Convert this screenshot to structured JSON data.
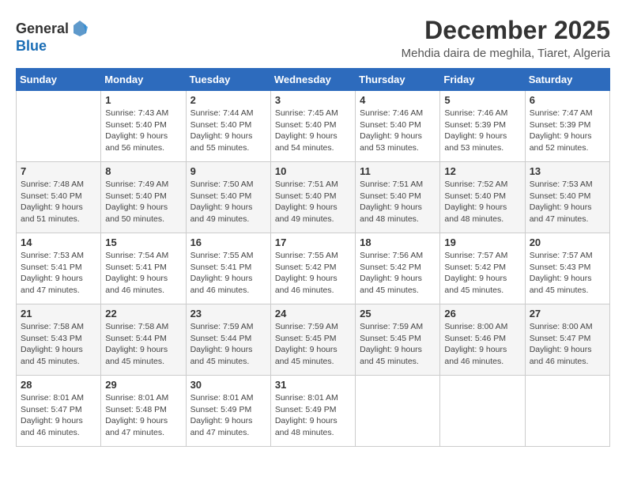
{
  "header": {
    "logo_general": "General",
    "logo_blue": "Blue",
    "title": "December 2025",
    "subtitle": "Mehdia daira de meghila, Tiaret, Algeria"
  },
  "weekdays": [
    "Sunday",
    "Monday",
    "Tuesday",
    "Wednesday",
    "Thursday",
    "Friday",
    "Saturday"
  ],
  "weeks": [
    [
      {
        "day": "",
        "info": ""
      },
      {
        "day": "1",
        "info": "Sunrise: 7:43 AM\nSunset: 5:40 PM\nDaylight: 9 hours\nand 56 minutes."
      },
      {
        "day": "2",
        "info": "Sunrise: 7:44 AM\nSunset: 5:40 PM\nDaylight: 9 hours\nand 55 minutes."
      },
      {
        "day": "3",
        "info": "Sunrise: 7:45 AM\nSunset: 5:40 PM\nDaylight: 9 hours\nand 54 minutes."
      },
      {
        "day": "4",
        "info": "Sunrise: 7:46 AM\nSunset: 5:40 PM\nDaylight: 9 hours\nand 53 minutes."
      },
      {
        "day": "5",
        "info": "Sunrise: 7:46 AM\nSunset: 5:39 PM\nDaylight: 9 hours\nand 53 minutes."
      },
      {
        "day": "6",
        "info": "Sunrise: 7:47 AM\nSunset: 5:39 PM\nDaylight: 9 hours\nand 52 minutes."
      }
    ],
    [
      {
        "day": "7",
        "info": "Sunrise: 7:48 AM\nSunset: 5:40 PM\nDaylight: 9 hours\nand 51 minutes."
      },
      {
        "day": "8",
        "info": "Sunrise: 7:49 AM\nSunset: 5:40 PM\nDaylight: 9 hours\nand 50 minutes."
      },
      {
        "day": "9",
        "info": "Sunrise: 7:50 AM\nSunset: 5:40 PM\nDaylight: 9 hours\nand 49 minutes."
      },
      {
        "day": "10",
        "info": "Sunrise: 7:51 AM\nSunset: 5:40 PM\nDaylight: 9 hours\nand 49 minutes."
      },
      {
        "day": "11",
        "info": "Sunrise: 7:51 AM\nSunset: 5:40 PM\nDaylight: 9 hours\nand 48 minutes."
      },
      {
        "day": "12",
        "info": "Sunrise: 7:52 AM\nSunset: 5:40 PM\nDaylight: 9 hours\nand 48 minutes."
      },
      {
        "day": "13",
        "info": "Sunrise: 7:53 AM\nSunset: 5:40 PM\nDaylight: 9 hours\nand 47 minutes."
      }
    ],
    [
      {
        "day": "14",
        "info": "Sunrise: 7:53 AM\nSunset: 5:41 PM\nDaylight: 9 hours\nand 47 minutes."
      },
      {
        "day": "15",
        "info": "Sunrise: 7:54 AM\nSunset: 5:41 PM\nDaylight: 9 hours\nand 46 minutes."
      },
      {
        "day": "16",
        "info": "Sunrise: 7:55 AM\nSunset: 5:41 PM\nDaylight: 9 hours\nand 46 minutes."
      },
      {
        "day": "17",
        "info": "Sunrise: 7:55 AM\nSunset: 5:42 PM\nDaylight: 9 hours\nand 46 minutes."
      },
      {
        "day": "18",
        "info": "Sunrise: 7:56 AM\nSunset: 5:42 PM\nDaylight: 9 hours\nand 45 minutes."
      },
      {
        "day": "19",
        "info": "Sunrise: 7:57 AM\nSunset: 5:42 PM\nDaylight: 9 hours\nand 45 minutes."
      },
      {
        "day": "20",
        "info": "Sunrise: 7:57 AM\nSunset: 5:43 PM\nDaylight: 9 hours\nand 45 minutes."
      }
    ],
    [
      {
        "day": "21",
        "info": "Sunrise: 7:58 AM\nSunset: 5:43 PM\nDaylight: 9 hours\nand 45 minutes."
      },
      {
        "day": "22",
        "info": "Sunrise: 7:58 AM\nSunset: 5:44 PM\nDaylight: 9 hours\nand 45 minutes."
      },
      {
        "day": "23",
        "info": "Sunrise: 7:59 AM\nSunset: 5:44 PM\nDaylight: 9 hours\nand 45 minutes."
      },
      {
        "day": "24",
        "info": "Sunrise: 7:59 AM\nSunset: 5:45 PM\nDaylight: 9 hours\nand 45 minutes."
      },
      {
        "day": "25",
        "info": "Sunrise: 7:59 AM\nSunset: 5:45 PM\nDaylight: 9 hours\nand 45 minutes."
      },
      {
        "day": "26",
        "info": "Sunrise: 8:00 AM\nSunset: 5:46 PM\nDaylight: 9 hours\nand 46 minutes."
      },
      {
        "day": "27",
        "info": "Sunrise: 8:00 AM\nSunset: 5:47 PM\nDaylight: 9 hours\nand 46 minutes."
      }
    ],
    [
      {
        "day": "28",
        "info": "Sunrise: 8:01 AM\nSunset: 5:47 PM\nDaylight: 9 hours\nand 46 minutes."
      },
      {
        "day": "29",
        "info": "Sunrise: 8:01 AM\nSunset: 5:48 PM\nDaylight: 9 hours\nand 47 minutes."
      },
      {
        "day": "30",
        "info": "Sunrise: 8:01 AM\nSunset: 5:49 PM\nDaylight: 9 hours\nand 47 minutes."
      },
      {
        "day": "31",
        "info": "Sunrise: 8:01 AM\nSunset: 5:49 PM\nDaylight: 9 hours\nand 48 minutes."
      },
      {
        "day": "",
        "info": ""
      },
      {
        "day": "",
        "info": ""
      },
      {
        "day": "",
        "info": ""
      }
    ]
  ]
}
